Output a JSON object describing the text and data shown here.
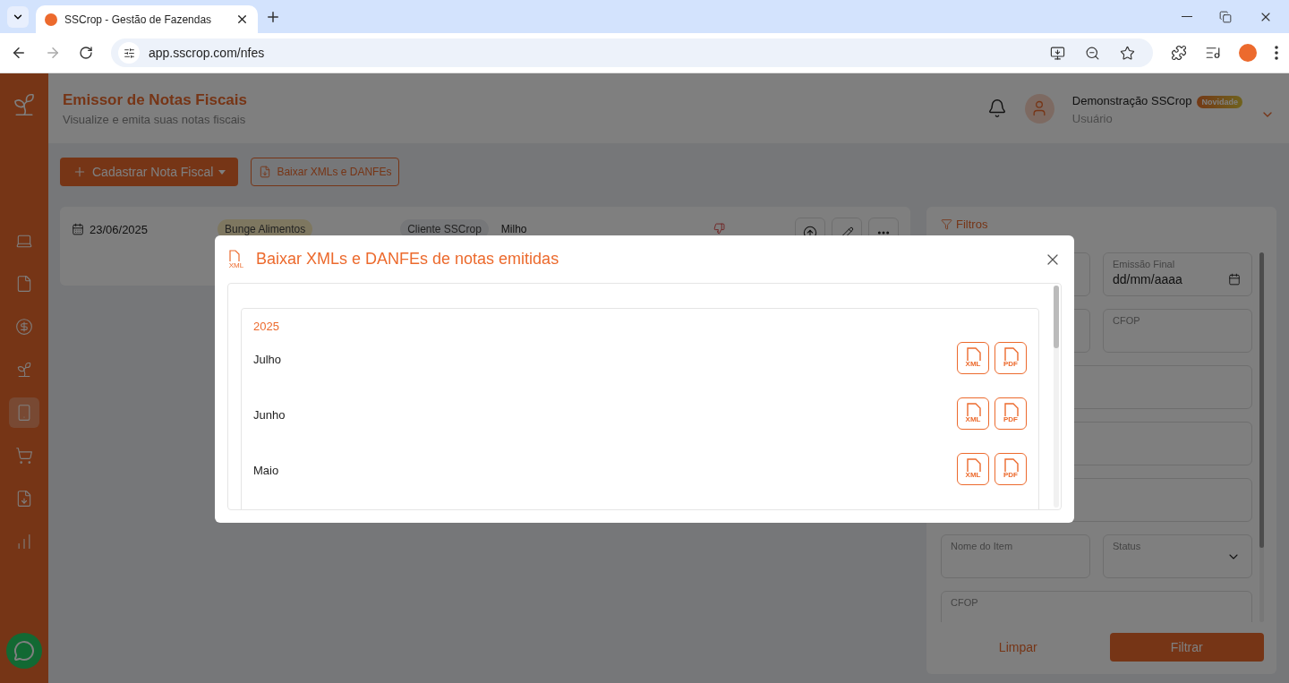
{
  "browser": {
    "tab_title": "SSCrop - Gestão de Fazendas",
    "url": "app.sscrop.com/nfes"
  },
  "sidebar": {
    "items": [
      {
        "kind": "laptop",
        "selected": false
      },
      {
        "kind": "file",
        "selected": false
      },
      {
        "kind": "money",
        "selected": false
      },
      {
        "kind": "plant",
        "selected": false
      },
      {
        "kind": "phone",
        "selected": true
      },
      {
        "kind": "cart",
        "selected": false
      },
      {
        "kind": "download",
        "selected": false
      },
      {
        "kind": "chart",
        "selected": false
      }
    ]
  },
  "header": {
    "title": "Emissor de Notas Fiscais",
    "subtitle": "Visualize e emita suas notas fiscais",
    "user_name": "Demonstração SSCrop",
    "badge": "Novidade",
    "role": "Usuário"
  },
  "toolbar": {
    "primary_button": "Cadastrar Nota Fiscal",
    "secondary_button": "Baixar XMLs e DANFEs"
  },
  "invoice_row": {
    "date": "23/06/2025",
    "supplier": "Bunge Alimentos",
    "client": "Cliente SSCrop",
    "product": "Milho"
  },
  "filters": {
    "title": "Filtros",
    "fields": [
      {
        "kind": "blank",
        "wide": false
      },
      {
        "kind": "date",
        "wide": false,
        "label": "Emissão Final",
        "value": "dd/mm/aaaa"
      },
      {
        "kind": "blank",
        "wide": false
      },
      {
        "kind": "text",
        "wide": false,
        "label": "CFOP"
      },
      {
        "kind": "blank",
        "wide": true
      },
      {
        "kind": "blank",
        "wide": true
      },
      {
        "kind": "blank",
        "wide": true
      },
      {
        "kind": "text",
        "wide": false,
        "label": "Nome do Item"
      },
      {
        "kind": "select",
        "wide": false,
        "label": "Status"
      },
      {
        "kind": "text",
        "wide": true,
        "label": "CFOP"
      }
    ],
    "clear_button": "Limpar",
    "apply_button": "Filtrar"
  },
  "modal": {
    "title": "Baixar XMLs e DANFEs de notas emitidas",
    "title_icon_label": "XML",
    "year": "2025",
    "months": [
      {
        "name": "Julho",
        "files": [
          "XML",
          "PDF"
        ]
      },
      {
        "name": "Junho",
        "files": [
          "XML",
          "PDF"
        ]
      },
      {
        "name": "Maio",
        "files": [
          "XML",
          "PDF"
        ]
      }
    ]
  }
}
